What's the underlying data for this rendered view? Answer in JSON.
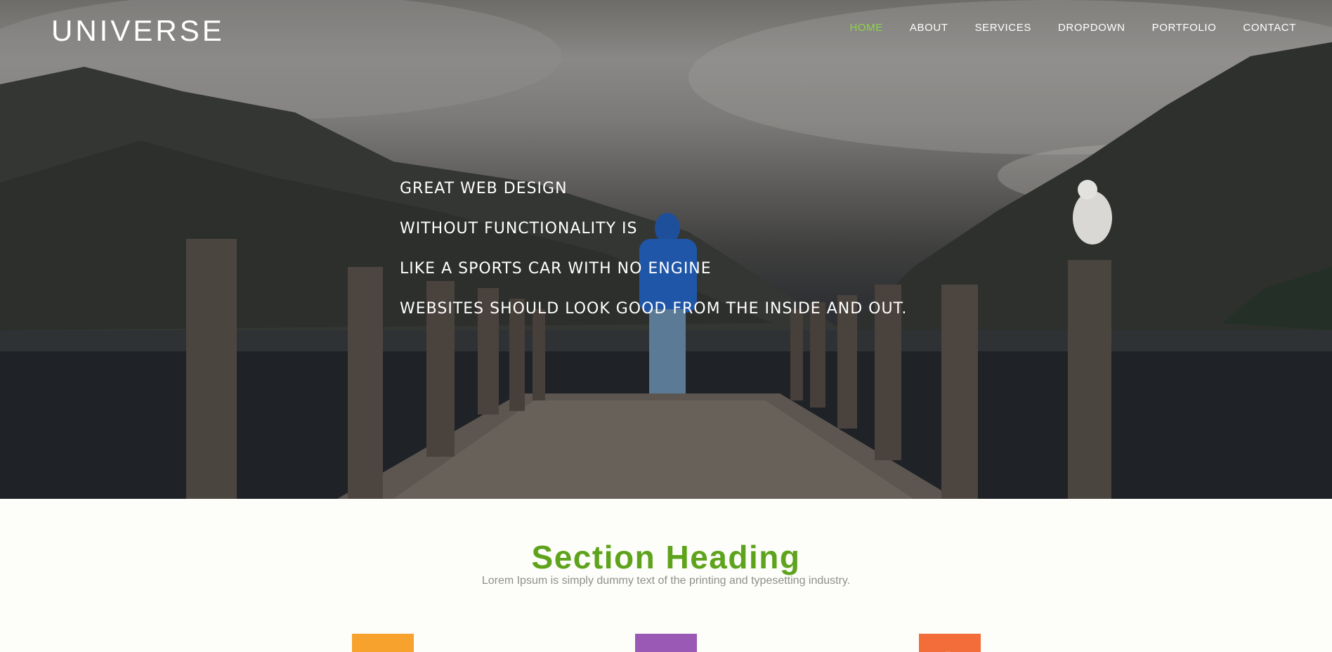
{
  "brand": {
    "logo_text": "UNIVERSE"
  },
  "nav": {
    "items": [
      {
        "label": "HOME",
        "active": true
      },
      {
        "label": "ABOUT",
        "active": false
      },
      {
        "label": "SERVICES",
        "active": false
      },
      {
        "label": "DROPDOWN",
        "active": false
      },
      {
        "label": "PORTFOLIO",
        "active": false
      },
      {
        "label": "CONTACT",
        "active": false
      }
    ],
    "active_color": "#8dd44a"
  },
  "hero": {
    "lines": [
      "GREAT WEB DESIGN",
      "WITHOUT FUNCTIONALITY IS",
      "LIKE A SPORTS CAR WITH NO ENGINE",
      "WEBSITES SHOULD LOOK GOOD FROM THE INSIDE AND OUT."
    ]
  },
  "section": {
    "heading": "Section Heading",
    "subtitle": "Lorem Ipsum is simply dummy text of the printing and typesetting industry.",
    "heading_color": "#5ea31c",
    "features": [
      {
        "icon": "document-icon",
        "color": "#f7a22d"
      },
      {
        "icon": "square-icon",
        "color": "#9b59b6"
      },
      {
        "icon": "arrow-icon",
        "color": "#f26d3a"
      }
    ]
  }
}
